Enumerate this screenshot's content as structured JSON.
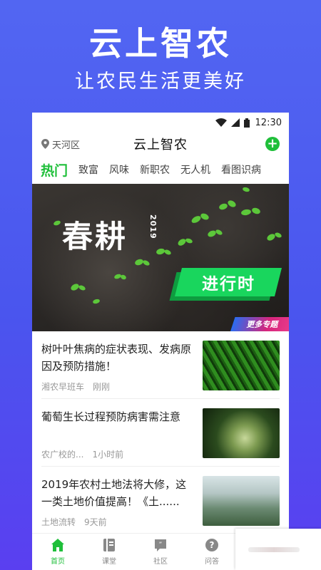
{
  "promo": {
    "title": "云上智农",
    "subtitle": "让农民生活更美好"
  },
  "status_bar": {
    "time": "12:30",
    "icons": [
      "wifi-icon",
      "signal-icon",
      "battery-icon"
    ]
  },
  "header": {
    "location": "天河区",
    "title": "云上智农",
    "add_icon": "+"
  },
  "tabs": [
    {
      "label": "热门",
      "active": true
    },
    {
      "label": "致富",
      "active": false
    },
    {
      "label": "风味",
      "active": false
    },
    {
      "label": "新职农",
      "active": false
    },
    {
      "label": "无人机",
      "active": false
    },
    {
      "label": "看图识病",
      "active": false
    }
  ],
  "banner": {
    "main_text": "春耕",
    "year": "2019",
    "tag": "进行时",
    "more_label": "更多专题"
  },
  "articles": [
    {
      "title": "树叶叶焦病的症状表现、发病原因及预防措施！",
      "source": "湘农早班车",
      "time": "刚刚"
    },
    {
      "title": "葡萄生长过程预防病害需注意",
      "source": "农广校的...",
      "time": "1小时前"
    },
    {
      "title": "2019年农村土地法将大修，这一类土地价值提高！《土......",
      "source": "土地流转",
      "time": "9天前"
    }
  ],
  "bottom_nav": [
    {
      "label": "首页",
      "icon": "home-icon",
      "active": true
    },
    {
      "label": "课堂",
      "icon": "book-icon",
      "active": false
    },
    {
      "label": "社区",
      "icon": "community-icon",
      "active": false
    },
    {
      "label": "问答",
      "icon": "question-icon",
      "active": false
    }
  ],
  "colors": {
    "accent": "#1fbf3a",
    "background": "#4f5ff0"
  }
}
